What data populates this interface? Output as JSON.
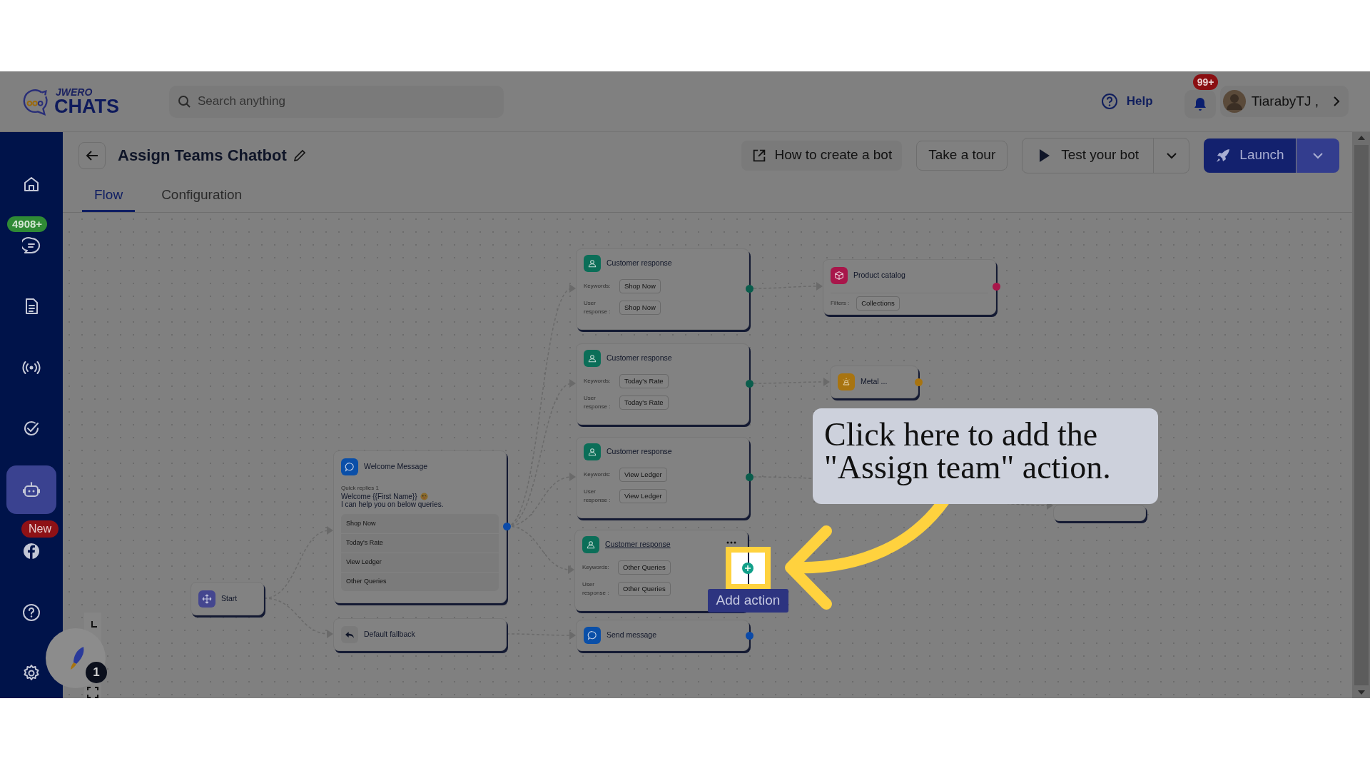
{
  "header": {
    "logo": {
      "top": "JWERO",
      "bottom": "CHATS"
    },
    "search": {
      "placeholder": "Search anything"
    },
    "help": "Help",
    "notifications": {
      "badge": "99+"
    },
    "user": {
      "name": "TiarabyTJ ,"
    }
  },
  "sidebar": {
    "items": [
      {
        "selected": false
      },
      {
        "selected": false,
        "badge": "4908+"
      },
      {
        "selected": false
      },
      {
        "selected": false
      },
      {
        "selected": false
      },
      {
        "selected": true
      },
      {
        "selected": false,
        "badge": "New"
      },
      {
        "selected": false
      },
      {
        "selected": false
      }
    ]
  },
  "bot": {
    "title": "Assign Teams Chatbot",
    "buttons": [
      "How to create a bot",
      "Take a tour",
      "Test your bot",
      "Launch"
    ]
  },
  "tabs": [
    {
      "label": "Flow",
      "selected": true
    },
    {
      "label": "Configuration",
      "selected": false
    }
  ],
  "flow": {
    "nodes": [
      {
        "kind": "start",
        "title": "Start"
      },
      {
        "kind": "message",
        "title": "Welcome Message",
        "caption": "Quick replies 1",
        "text": "Welcome {{First Name}}",
        "text_after": "I can help you on below queries.",
        "replies": [
          "Shop Now",
          "Today's Rate",
          "View Ledger",
          "Other Queries"
        ]
      },
      {
        "kind": "fallback",
        "title": "Default fallback"
      },
      {
        "kind": "customer_response",
        "title": "Customer response",
        "hovered": false,
        "keywords_label": "Keywords:",
        "keyword": "Shop Now",
        "response_label": "User response :",
        "response": "Shop Now"
      },
      {
        "kind": "customer_response",
        "title": "Customer response",
        "hovered": false,
        "keywords_label": "Keywords:",
        "keyword": "Today's Rate",
        "response_label": "User response :",
        "response": "Today's Rate"
      },
      {
        "kind": "customer_response",
        "title": "Customer response",
        "hovered": false,
        "keywords_label": "Keywords:",
        "keyword": "View Ledger",
        "response_label": "User response :",
        "response": "View Ledger"
      },
      {
        "kind": "customer_response",
        "title": "Customer response",
        "hovered": true,
        "keywords_label": "Keywords:",
        "keyword": "Other Queries",
        "response_label": "User response :",
        "response": "Other Queries"
      },
      {
        "kind": "send_message",
        "title": "Send message"
      },
      {
        "kind": "product_catalog",
        "title": "Product catalog",
        "filters_label": "Filters :",
        "filter": "Collections"
      },
      {
        "kind": "metal",
        "title": "Metal ..."
      },
      {
        "kind": "failure"
      }
    ]
  },
  "tour": {
    "callout": "Click here to add the \"Assign team\" action.",
    "tooltip": "Add action",
    "step_badge": "1"
  }
}
